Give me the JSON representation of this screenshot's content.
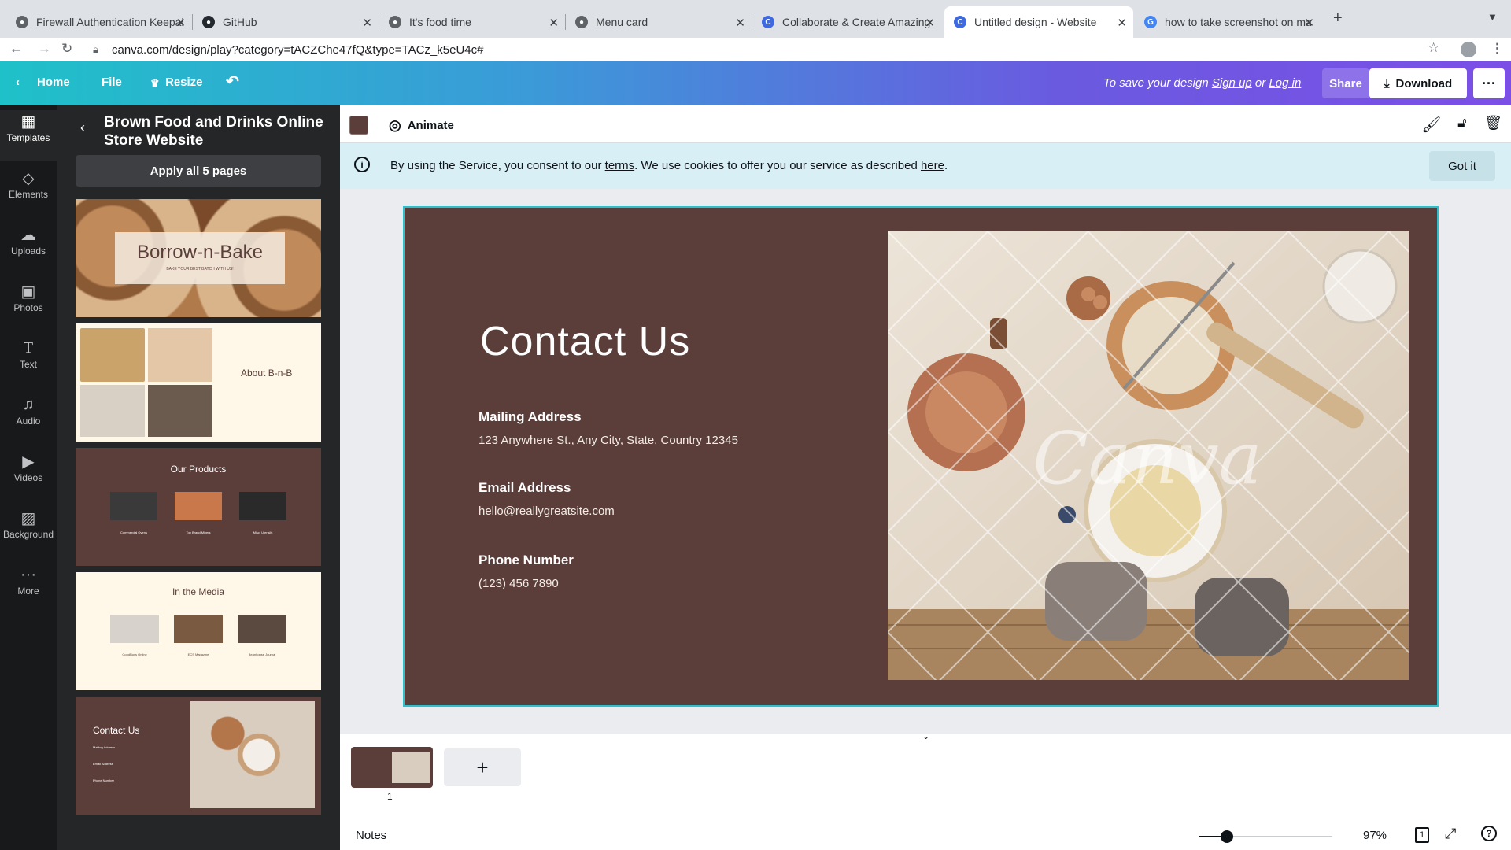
{
  "browser": {
    "tabs": [
      {
        "title": "Firewall Authentication Keepalive"
      },
      {
        "title": "GitHub"
      },
      {
        "title": "It's food time"
      },
      {
        "title": "Menu card"
      },
      {
        "title": "Collaborate & Create Amazing"
      },
      {
        "title": "Untitled design - Website"
      },
      {
        "title": "how to take screenshot on mac"
      }
    ],
    "url": "canva.com/design/play?category=tACZChe47fQ&type=TACz_k5eU4c#"
  },
  "topbar": {
    "home": "Home",
    "file": "File",
    "resize": "Resize",
    "save_prefix": "To save your design",
    "sign_up": "Sign up",
    "or": "or",
    "log_in": "Log in",
    "share": "Share",
    "download": "Download"
  },
  "rail": {
    "items": [
      {
        "label": "Templates",
        "icon": "templates-icon"
      },
      {
        "label": "Elements",
        "icon": "elements-icon"
      },
      {
        "label": "Uploads",
        "icon": "uploads-icon"
      },
      {
        "label": "Photos",
        "icon": "photos-icon"
      },
      {
        "label": "Text",
        "icon": "text-icon"
      },
      {
        "label": "Audio",
        "icon": "audio-icon"
      },
      {
        "label": "Videos",
        "icon": "videos-icon"
      },
      {
        "label": "Background",
        "icon": "background-icon"
      },
      {
        "label": "More",
        "icon": "more-icon"
      }
    ]
  },
  "panel": {
    "title": "Brown Food and Drinks Online Store Website",
    "apply": "Apply all 5 pages",
    "thumbs": {
      "t1_title": "Borrow-n-Bake",
      "t1_sub": "BAKE YOUR BEST BATCH WITH US!",
      "t2_title": "About B-n-B",
      "t3_title": "Our Products",
      "t3_items": [
        "Commercial Ovens",
        "Top Brand Mixers",
        "Misc. Utensils"
      ],
      "t4_title": "In the Media",
      "t4_items": [
        "GoodBuys Online",
        "ECS Magazine",
        "Beanhouse Journal"
      ],
      "t5_title": "Contact Us",
      "t5_lines": [
        "Mailing Address",
        "Email Address",
        "Phone Number"
      ]
    }
  },
  "editor": {
    "animate": "Animate",
    "swatch_color": "#5b3e3a",
    "cookie": {
      "pre": "By using the Service, you consent to our",
      "terms": "terms",
      "mid": ". We use cookies to offer you our service as described",
      "here": "here",
      "end": ".",
      "got_it": "Got it"
    },
    "design": {
      "title": "Contact Us",
      "mail_label": "Mailing Address",
      "mail_value": "123 Anywhere St., Any City, State, Country 12345",
      "email_label": "Email Address",
      "email_value": "hello@reallygreatsite.com",
      "phone_label": "Phone Number",
      "phone_value": "(123) 456 7890",
      "watermark": "Canva",
      "bg_color": "#5b3e3a"
    },
    "pages": {
      "current": "1",
      "add": "+"
    },
    "notes": "Notes",
    "zoom": "97%",
    "page_count": "1"
  }
}
